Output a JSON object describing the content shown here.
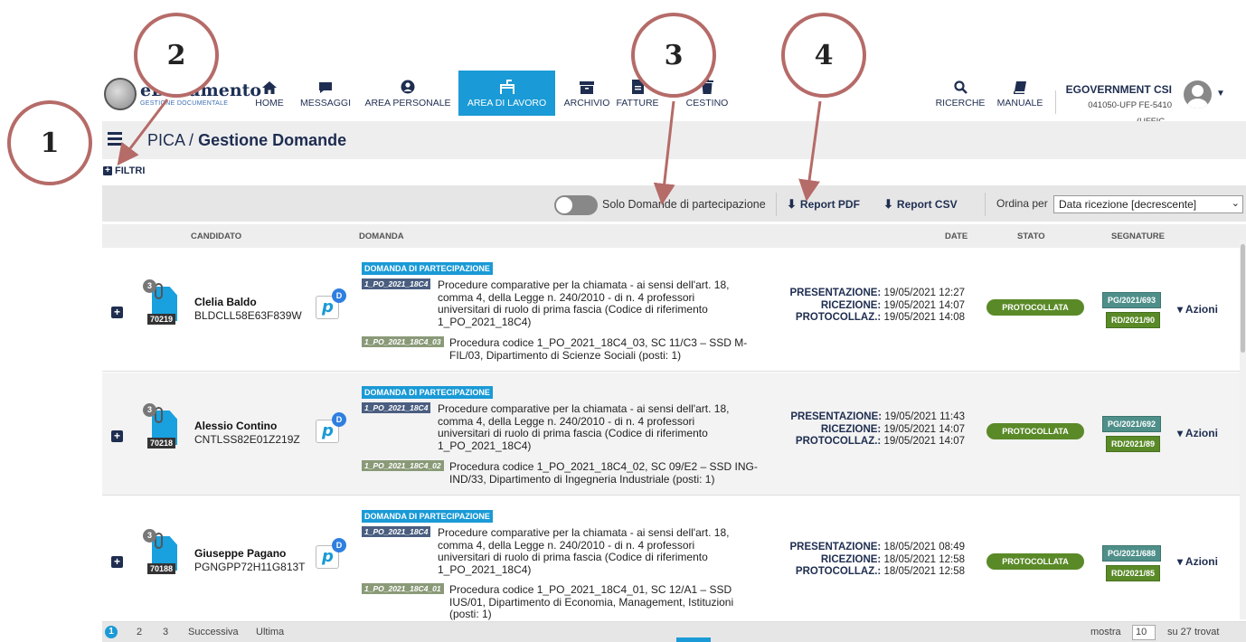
{
  "callouts": [
    "1",
    "2",
    "3",
    "4"
  ],
  "logo": {
    "title": "eDocumento",
    "subtitle": "GESTIONE DOCUMENTALE"
  },
  "nav": [
    {
      "label": "HOME",
      "icon": "home-icon"
    },
    {
      "label": "MESSAGGI",
      "icon": "chat-icon"
    },
    {
      "label": "AREA PERSONALE",
      "icon": "user-circle-icon"
    },
    {
      "label": "AREA DI LAVORO",
      "icon": "desk-icon",
      "active": true
    },
    {
      "label": "ARCHIVIO",
      "icon": "archive-icon"
    },
    {
      "label": "FATTURE",
      "icon": "invoice-icon"
    },
    {
      "label": "CESTINO",
      "icon": "trash-icon"
    },
    {
      "label": "RICERCHE",
      "icon": "search-icon"
    },
    {
      "label": "MANUALE",
      "icon": "book-icon"
    }
  ],
  "user": {
    "name": "EGOVERNMENT CSI",
    "office": "041050-UFP FE-5410 (UFFIC..."
  },
  "breadcrumb": {
    "parent": "PICA",
    "sep": "/",
    "current": "Gestione Domande"
  },
  "filters_label": "FILTRI",
  "toolbar": {
    "toggle_label": "Solo Domande di partecipazione",
    "report_pdf": "Report PDF",
    "report_csv": "Report CSV",
    "sort_label": "Ordina per",
    "sort_value": "Data ricezione [decrescente]"
  },
  "table_headers": {
    "candidato": "CANDIDATO",
    "domanda": "DOMANDA",
    "date": "DATE",
    "stato": "STATO",
    "segnature": "SEGNATURE"
  },
  "rows": [
    {
      "attachments": "3",
      "id": "70219",
      "name": "Clelia Baldo",
      "cf": "BLDCLL58E63F839W",
      "badge_d": "D",
      "type": "DOMANDA DI PARTECIPAZIONE",
      "code1": "1_PO_2021_18C4",
      "desc1": [
        "Procedure comparative per la chiamata - ai sensi dell'art. 18,",
        "comma 4, della Legge n. 240/2010 - di n. 4 professori",
        "universitari di ruolo di prima fascia (Codice di riferimento",
        "1_PO_2021_18C4)"
      ],
      "code2": "1_PO_2021_18C4_03",
      "desc2": [
        "Procedura codice 1_PO_2021_18C4_03, SC 11/C3 – SSD M-",
        "FIL/03,  Dipartimento di Scienze Sociali (posti: 1)"
      ],
      "pres_label": "PRESENTAZIONE:",
      "pres": "19/05/2021 12:27",
      "ric_label": "RICEZIONE:",
      "ric": "19/05/2021 14:07",
      "prot_label": "PROTOCOLLAZ.:",
      "prot": "19/05/2021 14:08",
      "stato": "PROTOCOLLATA",
      "seg1": "PG/2021/693",
      "seg2": "RD/2021/90",
      "azioni": "Azioni"
    },
    {
      "attachments": "3",
      "id": "70218",
      "name": "Alessio Contino",
      "cf": "CNTLSS82E01Z219Z",
      "badge_d": "D",
      "type": "DOMANDA DI PARTECIPAZIONE",
      "code1": "1_PO_2021_18C4",
      "desc1": [
        "Procedure comparative per la chiamata - ai sensi dell'art. 18,",
        "comma 4, della Legge n. 240/2010 - di n. 4 professori",
        "universitari di ruolo di prima fascia (Codice di riferimento",
        "1_PO_2021_18C4)"
      ],
      "code2": "1_PO_2021_18C4_02",
      "desc2": [
        "Procedura codice 1_PO_2021_18C4_02, SC 09/E2 – SSD ING-",
        "IND/33,  Dipartimento di Ingegneria Industriale (posti: 1)"
      ],
      "pres_label": "PRESENTAZIONE:",
      "pres": "19/05/2021 11:43",
      "ric_label": "RICEZIONE:",
      "ric": "19/05/2021 14:07",
      "prot_label": "PROTOCOLLAZ.:",
      "prot": "19/05/2021 14:07",
      "stato": "PROTOCOLLATA",
      "seg1": "PG/2021/692",
      "seg2": "RD/2021/89",
      "azioni": "Azioni"
    },
    {
      "attachments": "3",
      "id": "70188",
      "name": "Giuseppe Pagano",
      "cf": "PGNGPP72H11G813T",
      "badge_d": "D",
      "type": "DOMANDA DI PARTECIPAZIONE",
      "code1": "1_PO_2021_18C4",
      "desc1": [
        "Procedure comparative per la chiamata - ai sensi dell'art. 18,",
        "comma 4, della Legge n. 240/2010 - di n. 4 professori",
        "universitari di ruolo di prima fascia (Codice di riferimento",
        "1_PO_2021_18C4)"
      ],
      "code2": "1_PO_2021_18C4_01",
      "desc2": [
        "Procedura codice 1_PO_2021_18C4_01, SC 12/A1 – SSD",
        "IUS/01,  Dipartimento di Economia, Management, Istituzioni",
        "(posti: 1)"
      ],
      "pres_label": "PRESENTAZIONE:",
      "pres": "18/05/2021 08:49",
      "ric_label": "RICEZIONE:",
      "ric": "18/05/2021 12:58",
      "prot_label": "PROTOCOLLAZ.:",
      "prot": "18/05/2021 12:58",
      "stato": "PROTOCOLLATA",
      "seg1": "PG/2021/688",
      "seg2": "RD/2021/85",
      "azioni": "Azioni"
    }
  ],
  "pagination": {
    "pages": [
      "1",
      "2",
      "3"
    ],
    "next": "Successiva",
    "last": "Ultima",
    "show_label": "mostra",
    "show_value": "10",
    "total": "su 27 trovat"
  }
}
